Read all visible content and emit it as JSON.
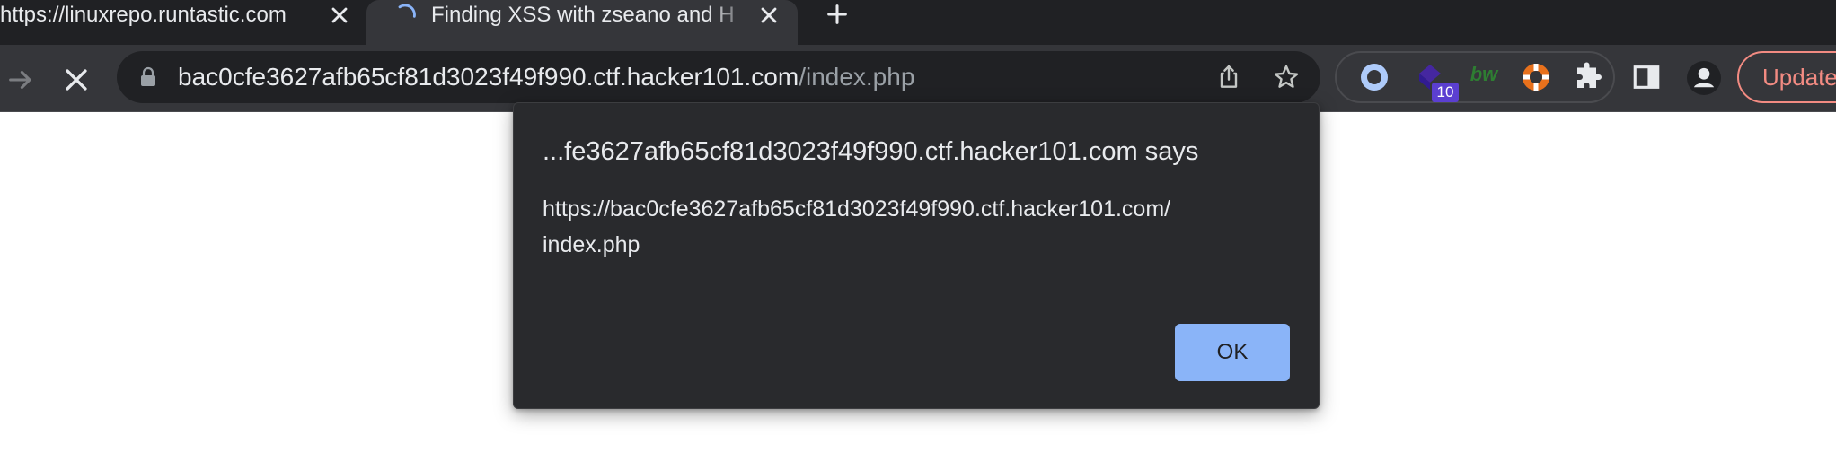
{
  "tabs": [
    {
      "title": "https://linuxrepo.runtastic.com",
      "active": false,
      "loading": false
    },
    {
      "title": "Finding XSS with zseano and H",
      "active": true,
      "loading": true
    }
  ],
  "toolbar": {
    "url_host": "bac0cfe3627afb65cf81d3023f49f990.ctf.hacker101.com",
    "url_path": "/index.php",
    "extensions": [
      {
        "icon": "ring-extension-icon"
      },
      {
        "icon": "purple-extension-icon",
        "badge": "10"
      },
      {
        "icon": "bw-extension-icon",
        "text": "bw"
      },
      {
        "icon": "lifebuoy-extension-icon"
      },
      {
        "icon": "puzzle-extensions-icon"
      }
    ],
    "update_label": "Update"
  },
  "dialog": {
    "title": "...fe3627afb65cf81d3023f49f990.ctf.hacker101.com says",
    "message": "https://bac0cfe3627afb65cf81d3023f49f990.ctf.hacker101.com/\nindex.php",
    "ok_label": "OK"
  },
  "colors": {
    "tabstrip_bg": "#202124",
    "toolbar_bg": "#35363a",
    "dialog_bg": "#292a2d",
    "ok_button_bg": "#8ab4f8",
    "update_accent": "#f28b82"
  }
}
